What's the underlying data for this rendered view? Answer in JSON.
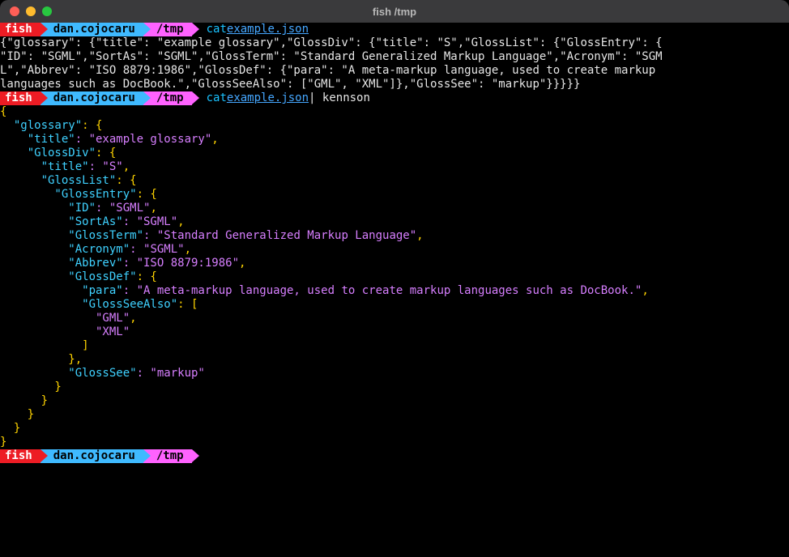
{
  "window": {
    "title": "fish /tmp"
  },
  "prompt": {
    "shell": "fish",
    "user": "dan.cojocaru",
    "path": "/tmp"
  },
  "cmd1": {
    "cat": "cat ",
    "file": "example.json"
  },
  "cmd2": {
    "cat": "cat ",
    "file": "example.json",
    "rest": " | kennson"
  },
  "raw": {
    "l1": "{\"glossary\": {\"title\": \"example glossary\",\"GlossDiv\": {\"title\": \"S\",\"GlossList\": {\"GlossEntry\": {",
    "l2": "\"ID\": \"SGML\",\"SortAs\": \"SGML\",\"GlossTerm\": \"Standard Generalized Markup Language\",\"Acronym\": \"SGM",
    "l3": "L\",\"Abbrev\": \"ISO 8879:1986\",\"GlossDef\": {\"para\": \"A meta-markup language, used to create markup ",
    "l4": "languages such as DocBook.\",\"GlossSeeAlso\": [\"GML\", \"XML\"]},\"GlossSee\": \"markup\"}}}}}"
  },
  "pretty": {
    "open": "{",
    "glossary_key": "  \"glossary\"",
    "glossary_brace": ": {",
    "title_key": "    \"title\"",
    "title_val": ": \"example glossary\"",
    "title_comma": ",",
    "glossdiv_key": "    \"GlossDiv\"",
    "glossdiv_brace": ": {",
    "title2_key": "      \"title\"",
    "title2_val": ": \"S\"",
    "title2_comma": ",",
    "glosslist_key": "      \"GlossList\"",
    "glosslist_brace": ": {",
    "glossentry_key": "        \"GlossEntry\"",
    "glossentry_brace": ": {",
    "id_key": "          \"ID\"",
    "id_val": ": \"SGML\"",
    "id_comma": ",",
    "sortas_key": "          \"SortAs\"",
    "sortas_val": ": \"SGML\"",
    "sortas_comma": ",",
    "glossterm_key": "          \"GlossTerm\"",
    "glossterm_val": ": \"Standard Generalized Markup Language\"",
    "glossterm_comma": ",",
    "acronym_key": "          \"Acronym\"",
    "acronym_val": ": \"SGML\"",
    "acronym_comma": ",",
    "abbrev_key": "          \"Abbrev\"",
    "abbrev_val": ": \"ISO 8879:1986\"",
    "abbrev_comma": ",",
    "glossdef_key": "          \"GlossDef\"",
    "glossdef_brace": ": {",
    "para_key": "            \"para\"",
    "para_val": ": \"A meta-markup language, used to create markup languages such as DocBook.\"",
    "para_comma": ",",
    "seealso_key": "            \"GlossSeeAlso\"",
    "seealso_brace": ": [",
    "gml": "              \"GML\"",
    "gml_comma": ",",
    "xml": "              \"XML\"",
    "arr_close": "            ]",
    "glossdef_close": "          }",
    "glossdef_comma": ",",
    "glosssee_key": "          \"GlossSee\"",
    "glosssee_val": ": \"markup\"",
    "glossentry_close": "        }",
    "glosslist_close": "      }",
    "glossdiv_close": "    }",
    "glossary_close": "  }",
    "close": "}"
  }
}
